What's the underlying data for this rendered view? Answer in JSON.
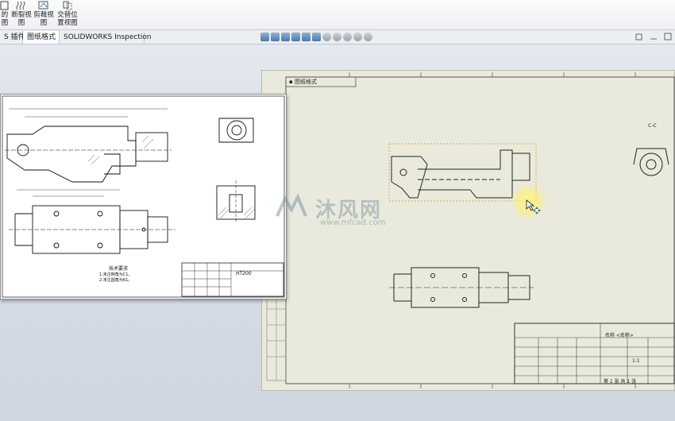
{
  "ribbon": {
    "tools": [
      {
        "label_line1": "的",
        "label_line2": "图",
        "icon": "view-icon"
      },
      {
        "label_line1": "断裂视",
        "label_line2": "图",
        "icon": "broken-view-icon"
      },
      {
        "label_line1": "剪裁视",
        "label_line2": "图",
        "icon": "crop-view-icon"
      },
      {
        "label_line1": "交替位",
        "label_line2": "置视图",
        "icon": "alternate-position-view-icon"
      }
    ]
  },
  "tabs": [
    {
      "label": "S 插件"
    },
    {
      "label": "图纸格式"
    },
    {
      "label": "SOLIDWORKS Inspection"
    }
  ],
  "drawing_left": {
    "tech_req_title": "技术要求",
    "tech_req_line1": "1.未注倒角为C1。",
    "tech_req_line2": "2.未注圆角为R1。",
    "material": "HT200"
  },
  "drawing_right": {
    "top_label": "▪ 图纸格式",
    "section_label": "C-C",
    "title_block_name": "名称 <名称>",
    "title_block_scale": "1:1",
    "title_block_sheet": "第 1 张 共 1 张"
  },
  "watermark": {
    "name": "沐风网",
    "url": "www.mfcad.com"
  }
}
